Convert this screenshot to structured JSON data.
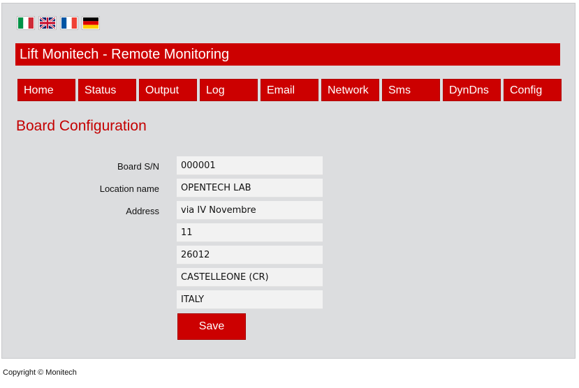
{
  "header": {
    "title": "Lift Monitech - Remote Monitoring"
  },
  "languages": [
    {
      "name": "italian-flag-icon"
    },
    {
      "name": "uk-flag-icon"
    },
    {
      "name": "french-flag-icon"
    },
    {
      "name": "german-flag-icon"
    }
  ],
  "nav": {
    "items": [
      {
        "label": "Home"
      },
      {
        "label": "Status"
      },
      {
        "label": "Output"
      },
      {
        "label": "Log"
      },
      {
        "label": "Email"
      },
      {
        "label": "Network"
      },
      {
        "label": "Sms"
      },
      {
        "label": "DynDns"
      },
      {
        "label": "Config"
      }
    ]
  },
  "page": {
    "title": "Board Configuration"
  },
  "form": {
    "board_sn_label": "Board S/N",
    "board_sn": "000001",
    "location_label": "Location name",
    "location": "OPENTECH LAB",
    "address_label": "Address",
    "address_street": "via IV Novembre",
    "address_number": "11",
    "address_zip": "26012",
    "address_city": "CASTELLEONE (CR)",
    "address_country": "ITALY",
    "save_label": "Save"
  },
  "footer": {
    "copyright": "Copyright © Monitech"
  },
  "colors": {
    "accent": "#cc0000",
    "panel_bg": "#dcdddf",
    "input_bg": "#f2f2f2"
  }
}
